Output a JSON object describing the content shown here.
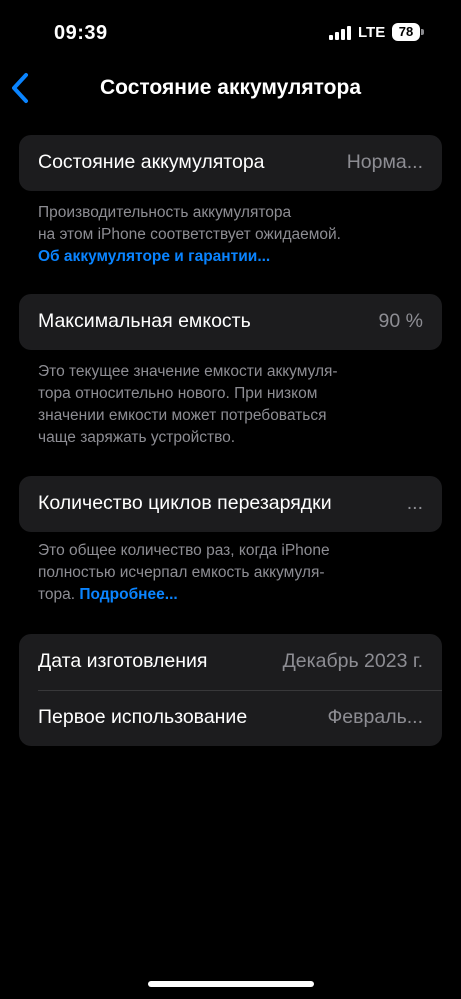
{
  "status_bar": {
    "time": "09:39",
    "network": "LTE",
    "battery_level": "78"
  },
  "nav": {
    "back_icon": "chevron-left-icon",
    "title": "Состояние аккумулятора"
  },
  "battery_health": {
    "label": "Состояние аккумулятора",
    "value": "Норма...",
    "note_line1": "Производительность аккумулятора",
    "note_line2": "на этом iPhone соответствует ожидаемой.",
    "note_link": "Об аккумуляторе и гарантии..."
  },
  "max_capacity": {
    "label": "Максимальная емкость",
    "value": "90 %",
    "note_line1": "Это текущее значение емкости аккумуля-",
    "note_line2": "тора относительно нового. При низком",
    "note_line3": "значении емкости может потребоваться",
    "note_line4": "чаще заряжать устройство."
  },
  "cycle_count": {
    "label": "Количество циклов перезарядки",
    "value": "...",
    "note_line1": "Это общее количество раз, когда iPhone",
    "note_line2": "полностью исчерпал емкость аккумуля-",
    "note_line3_text": "тора.",
    "note_link": "Подробнее..."
  },
  "dates": {
    "manufacture_label": "Дата изготовления",
    "manufacture_value": "Декабрь 2023 г.",
    "first_use_label": "Первое использование",
    "first_use_value": "Февраль..."
  },
  "colors": {
    "background": "#000000",
    "card": "#1c1c1e",
    "secondary_text": "#8d8d93",
    "accent": "#0a84ff"
  }
}
